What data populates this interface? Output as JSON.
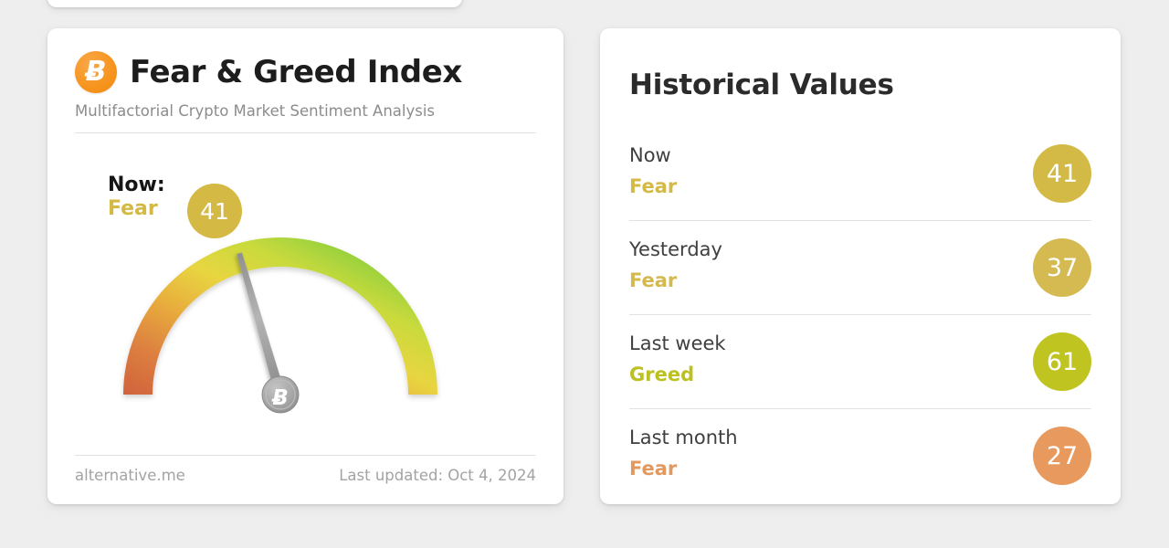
{
  "theme": {
    "page_background": "#eeeeee",
    "card_background": "#ffffff",
    "divider": "#e2e2e2",
    "brand_orange": "#f6941d",
    "fear_gold": "#d4b944",
    "greed_olive": "#c0c420",
    "fear_orange": "#e89a5e",
    "needle_gray": "#9a9a9a"
  },
  "gauge_card": {
    "logo_icon": "bitcoin-icon",
    "logo_glyph": "Ƀ",
    "title": "Fear & Greed Index",
    "subtitle": "Multifactorial Crypto Market Sentiment Analysis",
    "now_label": "Now:",
    "now_classification": "Fear",
    "now_value": "41",
    "needle_hub_glyph": "Ƀ",
    "footer": {
      "source": "alternative.me",
      "last_updated": "Last updated: Oct 4, 2024"
    }
  },
  "chart_data": {
    "type": "gauge",
    "title": "Fear & Greed Index",
    "value": 41,
    "value_label": "41",
    "classification": "Fear",
    "min": 0,
    "max": 100,
    "start_angle_deg": 180,
    "end_angle_deg": 360,
    "needle_angle_deg": 253.8,
    "grid": false,
    "legend": "none",
    "color_stops": [
      {
        "position": 0,
        "color": "#d0623c"
      },
      {
        "position": 0.16,
        "color": "#d97a3e"
      },
      {
        "position": 0.33,
        "color": "#e5a33c"
      },
      {
        "position": 0.5,
        "color": "#e8d541"
      },
      {
        "position": 0.66,
        "color": "#c8d93c"
      },
      {
        "position": 0.84,
        "color": "#88ce3e"
      },
      {
        "position": 1,
        "color": "#5fc63c"
      }
    ]
  },
  "history_card": {
    "title": "Historical Values",
    "rows": [
      {
        "period": "Now",
        "classification": "Fear",
        "value": "41",
        "badge_color": "#d3b945",
        "text_color": "#d4b944"
      },
      {
        "period": "Yesterday",
        "classification": "Fear",
        "value": "37",
        "badge_color": "#d5ba52",
        "text_color": "#d4b94f"
      },
      {
        "period": "Last week",
        "classification": "Greed",
        "value": "61",
        "badge_color": "#c0c420",
        "text_color": "#bcc121"
      },
      {
        "period": "Last month",
        "classification": "Fear",
        "value": "27",
        "badge_color": "#e89a5e",
        "text_color": "#e2995f"
      }
    ]
  }
}
